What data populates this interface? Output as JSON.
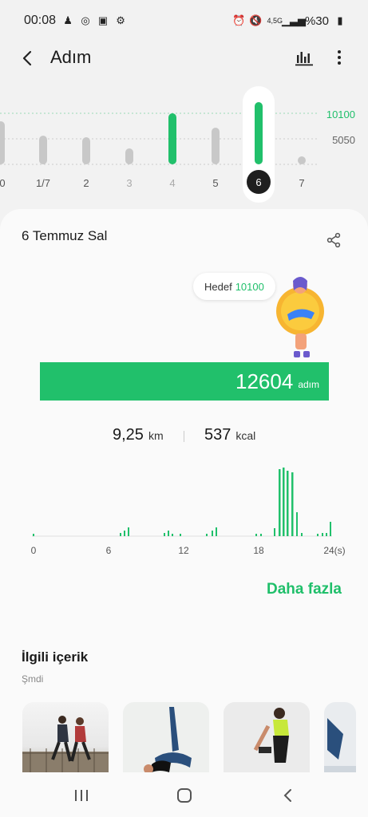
{
  "status": {
    "time": "00:08",
    "net": "4,5G",
    "battery": "%30"
  },
  "app": {
    "title": "Adım"
  },
  "week": {
    "goal_label": "10100",
    "half_label": "5050",
    "days": [
      "0",
      "1/7",
      "2",
      "3",
      "4",
      "5",
      "6",
      "7"
    ],
    "selected_day": "6"
  },
  "card": {
    "date": "6 Temmuz Sal",
    "goal_prefix": "Hedef",
    "goal_value": "10100",
    "steps": "12604",
    "steps_unit": "adım",
    "distance": "9,25",
    "distance_unit": "km",
    "calories": "537",
    "calories_unit": "kcal",
    "more": "Daha fazla"
  },
  "hourly": {
    "ticks": [
      "0",
      "6",
      "12",
      "18",
      "24(s)"
    ]
  },
  "related": {
    "title": "İlgili içerik",
    "subtitle": "Şmdi"
  },
  "icons": {
    "back": "back-arrow-icon",
    "chart": "bar-chart-icon",
    "more": "more-vert-icon",
    "share": "share-icon"
  },
  "colors": {
    "accent": "#21c06b",
    "dark": "#1a1a1a"
  }
}
